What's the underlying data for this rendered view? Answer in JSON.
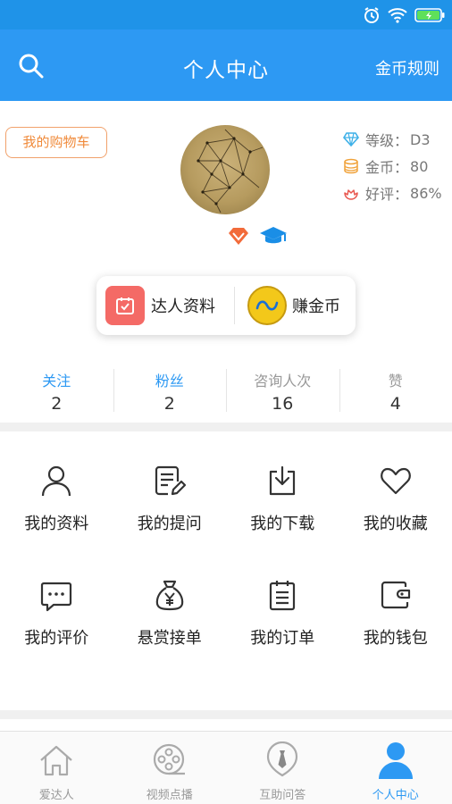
{
  "header": {
    "title": "个人中心",
    "rules_label": "金币规则"
  },
  "profile": {
    "cart_label": "我的购物车",
    "level": {
      "label": "等级：",
      "value": "D3"
    },
    "coins": {
      "label": "金币：",
      "value": "80"
    },
    "rating": {
      "label": "好评：",
      "value": "86%"
    }
  },
  "actions": {
    "expert_label": "达人资料",
    "earn_label": "赚金币"
  },
  "counts": [
    {
      "label": "关注",
      "value": "2"
    },
    {
      "label": "粉丝",
      "value": "2"
    },
    {
      "label": "咨询人次",
      "value": "16"
    },
    {
      "label": "赞",
      "value": "4"
    }
  ],
  "menu": [
    {
      "label": "我的资料",
      "icon": "user-icon"
    },
    {
      "label": "我的提问",
      "icon": "edit-document-icon"
    },
    {
      "label": "我的下载",
      "icon": "download-icon"
    },
    {
      "label": "我的收藏",
      "icon": "heart-icon"
    },
    {
      "label": "我的评价",
      "icon": "comment-icon"
    },
    {
      "label": "悬赏接单",
      "icon": "money-bag-icon"
    },
    {
      "label": "我的订单",
      "icon": "order-list-icon"
    },
    {
      "label": "我的钱包",
      "icon": "wallet-icon"
    }
  ],
  "tabs": [
    {
      "label": "爱达人",
      "icon": "home-icon"
    },
    {
      "label": "视频点播",
      "icon": "film-reel-icon"
    },
    {
      "label": "互助问答",
      "icon": "tie-icon"
    },
    {
      "label": "个人中心",
      "icon": "person-icon"
    }
  ],
  "colors": {
    "primary": "#2d99f3",
    "cart_border": "#f1a16b",
    "coin": "#f3c81a",
    "tile_red": "#f46a66"
  }
}
